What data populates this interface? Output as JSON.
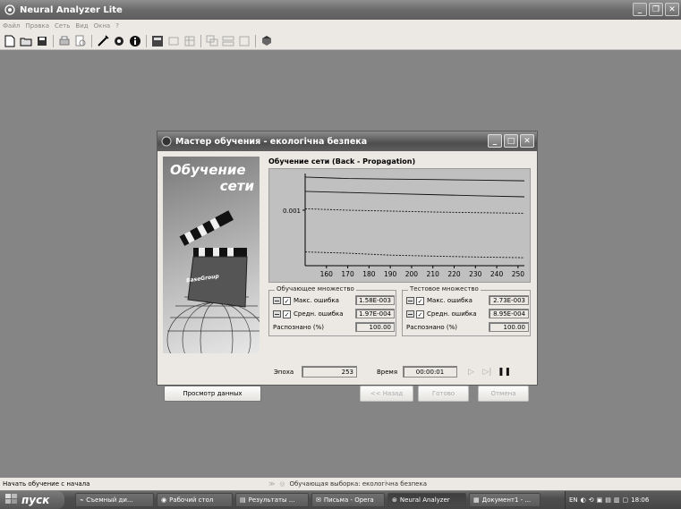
{
  "app": {
    "title": "Neural Analyzer Lite",
    "menu": [
      "Файл",
      "Правка",
      "Сеть",
      "Вид",
      "Окна",
      "?"
    ]
  },
  "dialog": {
    "title": "Мастер обучения - екологічна безпека",
    "art_title_1": "Обучение",
    "art_title_2": "сети",
    "art_brand": "BaseGroup",
    "section_title": "Обучение сети (Back - Propagation)",
    "train_group": {
      "legend": "Обучающее множество",
      "max_label": "Макс. ошибка",
      "max_value": "1.58E-003",
      "avg_label": "Средн. ошибка",
      "avg_value": "1.97E-004",
      "recog_label": "Распознано (%)",
      "recog_value": "100.00"
    },
    "test_group": {
      "legend": "Тестовое множество",
      "max_label": "Макс. ошибка",
      "max_value": "2.73E-003",
      "avg_label": "Средн. ошибка",
      "avg_value": "8.95E-004",
      "recog_label": "Распознано (%)",
      "recog_value": "100.00"
    },
    "epoch_label": "Эпоха",
    "epoch_value": "253",
    "time_label": "Время",
    "time_value": "00:00:01",
    "btn_view_data": "Просмотр данных",
    "btn_back": "<< Назад",
    "btn_done": "Готово",
    "btn_cancel": "Отмена"
  },
  "chart_data": {
    "type": "line",
    "x_ticks": [
      160,
      170,
      180,
      190,
      200,
      210,
      220,
      230,
      240,
      250
    ],
    "y_tick_label": "0.001",
    "y_log_scale": true,
    "xlim": [
      150,
      253
    ],
    "series": [
      {
        "style": "solid",
        "x": [
          150,
          170,
          190,
          210,
          230,
          253
        ],
        "values": [
          0.0031,
          0.00295,
          0.0029,
          0.00285,
          0.0028,
          0.00273
        ]
      },
      {
        "style": "solid",
        "x": [
          150,
          170,
          190,
          210,
          230,
          253
        ],
        "values": [
          0.0019,
          0.00183,
          0.00176,
          0.0017,
          0.00164,
          0.00158
        ]
      },
      {
        "style": "dashed",
        "x": [
          150,
          170,
          190,
          210,
          230,
          253
        ],
        "values": [
          0.00105,
          0.001,
          0.00097,
          0.00094,
          0.00092,
          0.0009
        ]
      },
      {
        "style": "dashed",
        "x": [
          150,
          170,
          190,
          210,
          230,
          253
        ],
        "values": [
          0.00024,
          0.00023,
          0.000215,
          0.000208,
          0.000202,
          0.000197
        ]
      }
    ]
  },
  "status": {
    "left": "Начать обучение с начала",
    "right": "Обучающая выборка: екологічна безпека"
  },
  "taskbar": {
    "start": "пуск",
    "tasks": [
      "Съемный ди...",
      "Рабочий стол",
      "Результаты ...",
      "Письма - Opera",
      "Neural Analyzer",
      "Документ1 - ..."
    ],
    "lang": "EN",
    "clock": "18:06"
  }
}
